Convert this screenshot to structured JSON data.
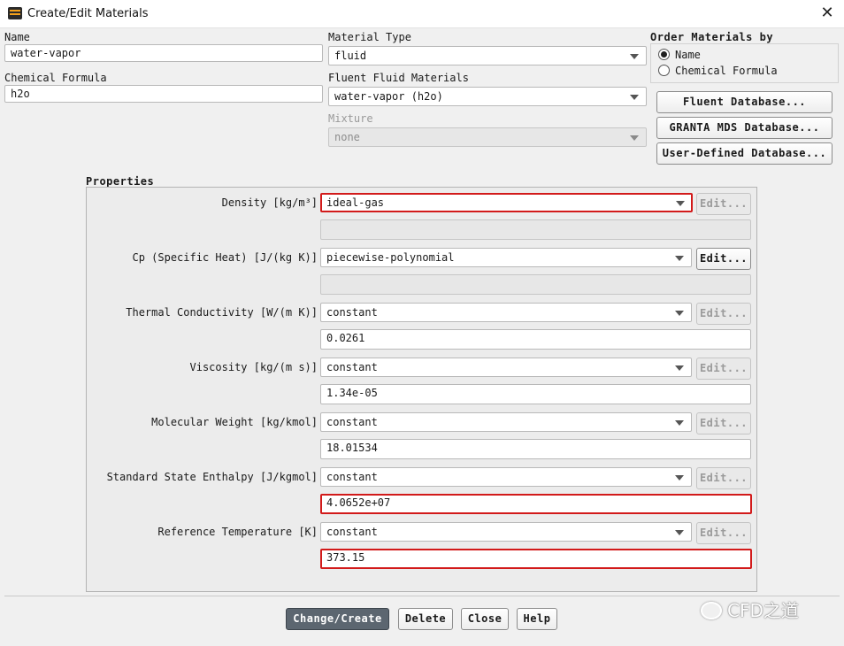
{
  "window": {
    "title": "Create/Edit Materials",
    "close_glyph": "✕",
    "app_icon": "ansys-fluent-icon"
  },
  "name": {
    "label": "Name",
    "value": "water-vapor"
  },
  "chemical_formula": {
    "label": "Chemical Formula",
    "value": "h2o"
  },
  "material_type": {
    "label": "Material Type",
    "value": "fluid"
  },
  "fluent_fluid_materials": {
    "label": "Fluent Fluid Materials",
    "value": "water-vapor (h2o)"
  },
  "mixture": {
    "label": "Mixture",
    "value": "none"
  },
  "order_by": {
    "title": "Order Materials by",
    "options": [
      {
        "label": "Name",
        "selected": true
      },
      {
        "label": "Chemical Formula",
        "selected": false
      }
    ]
  },
  "databases": {
    "fluent": "Fluent Database...",
    "granta": "GRANTA MDS Database...",
    "user_defined": "User-Defined Database..."
  },
  "properties": {
    "title": "Properties",
    "edit_label": "Edit...",
    "items": [
      {
        "label": "Density [kg/m³]",
        "method": "ideal-gas",
        "value": "",
        "edit_enabled": false,
        "highlight_method": true,
        "highlight_value": false
      },
      {
        "label": "Cp (Specific Heat) [J/(kg K)]",
        "method": "piecewise-polynomial",
        "value": "",
        "edit_enabled": true,
        "highlight_method": false,
        "highlight_value": false
      },
      {
        "label": "Thermal Conductivity [W/(m K)]",
        "method": "constant",
        "value": "0.0261",
        "edit_enabled": false,
        "highlight_method": false,
        "highlight_value": false
      },
      {
        "label": "Viscosity [kg/(m s)]",
        "method": "constant",
        "value": "1.34e-05",
        "edit_enabled": false,
        "highlight_method": false,
        "highlight_value": false
      },
      {
        "label": "Molecular Weight [kg/kmol]",
        "method": "constant",
        "value": "18.01534",
        "edit_enabled": false,
        "highlight_method": false,
        "highlight_value": false
      },
      {
        "label": "Standard State Enthalpy [J/kgmol]",
        "method": "constant",
        "value": "4.0652e+07",
        "edit_enabled": false,
        "highlight_method": false,
        "highlight_value": true
      },
      {
        "label": "Reference Temperature [K]",
        "method": "constant",
        "value": "373.15",
        "edit_enabled": false,
        "highlight_method": false,
        "highlight_value": true
      }
    ]
  },
  "footer": {
    "change_create": "Change/Create",
    "delete": "Delete",
    "close": "Close",
    "help": "Help"
  },
  "watermark": {
    "text": "CFD之道",
    "icon": "wechat-icon"
  },
  "colors": {
    "highlight": "#d21a1a",
    "primary_button": "#5c6670"
  }
}
